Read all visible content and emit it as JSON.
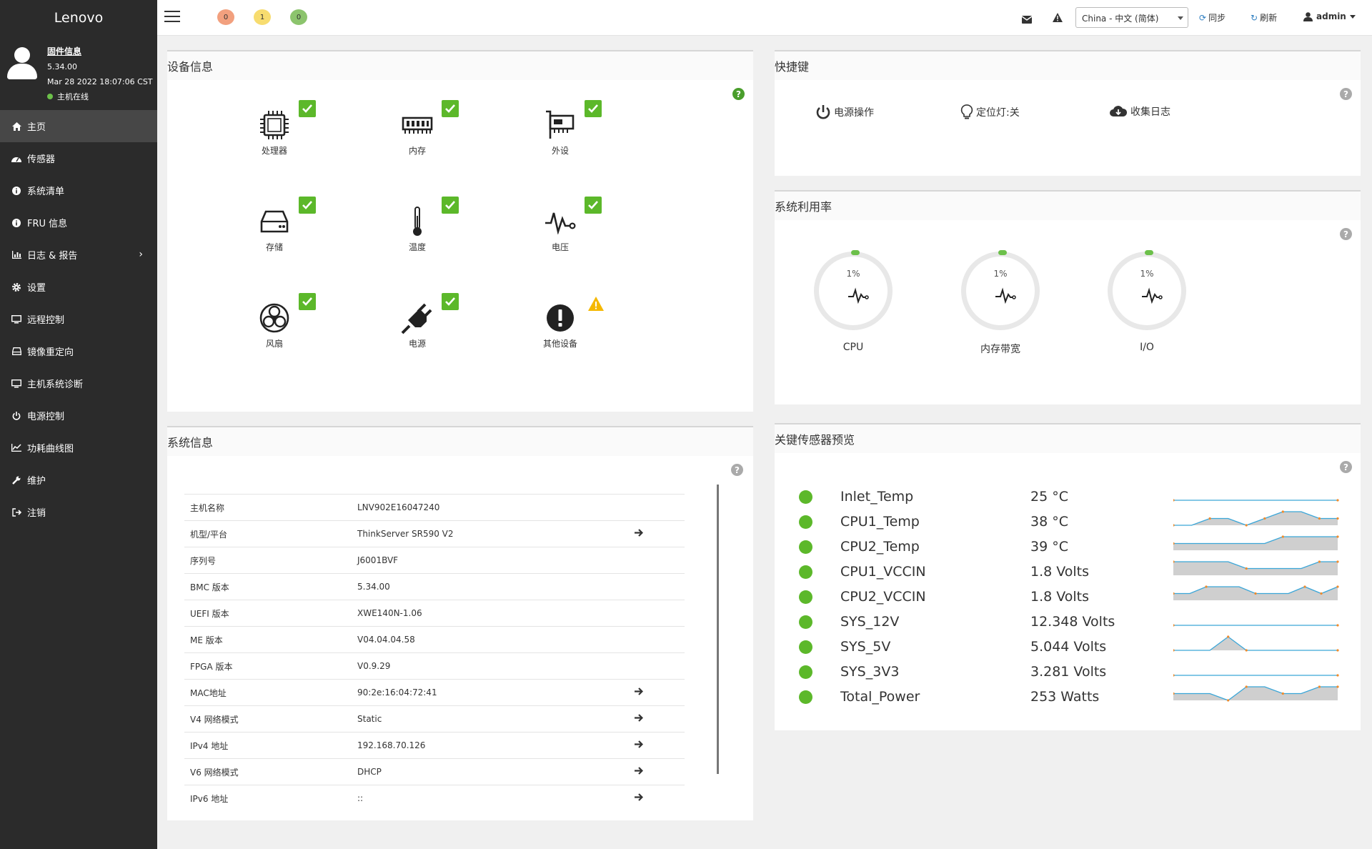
{
  "sidebar": {
    "brand": "Lenovo",
    "user": {
      "firmware_link": "固件信息",
      "version": "5.34.00",
      "datetime": "Mar 28 2022 18:07:06 CST",
      "status": "主机在线"
    },
    "items": [
      {
        "label": "主页",
        "icon": "home-icon"
      },
      {
        "label": "传感器",
        "icon": "dashboard-icon"
      },
      {
        "label": "系统清单",
        "icon": "info-icon"
      },
      {
        "label": "FRU 信息",
        "icon": "info-icon"
      },
      {
        "label": "日志 & 报告",
        "icon": "chart-icon"
      },
      {
        "label": "设置",
        "icon": "gear-icon"
      },
      {
        "label": "远程控制",
        "icon": "monitor-icon"
      },
      {
        "label": "镜像重定向",
        "icon": "disk-icon"
      },
      {
        "label": "主机系统诊断",
        "icon": "monitor-icon"
      },
      {
        "label": "电源控制",
        "icon": "power-icon"
      },
      {
        "label": "功耗曲线图",
        "icon": "line-chart-icon"
      },
      {
        "label": "维护",
        "icon": "wrench-icon"
      },
      {
        "label": "注销",
        "icon": "logout-icon"
      }
    ]
  },
  "topbar": {
    "badge_red": "0",
    "badge_yellow": "1",
    "badge_green": "0",
    "language": "China - 中文 (简体)",
    "sync": "同步",
    "refresh": "刷新",
    "user": "admin"
  },
  "device_info": {
    "title": "设备信息",
    "devices": [
      {
        "label": "处理器",
        "status": "ok"
      },
      {
        "label": "内存",
        "status": "ok"
      },
      {
        "label": "外设",
        "status": "ok"
      },
      {
        "label": "存储",
        "status": "ok"
      },
      {
        "label": "温度",
        "status": "ok"
      },
      {
        "label": "电压",
        "status": "ok"
      },
      {
        "label": "风扇",
        "status": "ok"
      },
      {
        "label": "电源",
        "status": "ok"
      },
      {
        "label": "其他设备",
        "status": "warning"
      }
    ]
  },
  "quick_keys": {
    "title": "快捷键",
    "power": "电源操作",
    "locator": "定位灯:关",
    "collect_log": "收集日志"
  },
  "utilization": {
    "title": "系统利用率",
    "gauges": [
      {
        "label": "CPU",
        "value": "1%"
      },
      {
        "label": "内存带宽",
        "value": "1%"
      },
      {
        "label": "I/O",
        "value": "1%"
      }
    ]
  },
  "system_info": {
    "title": "系统信息",
    "rows": [
      {
        "key": "主机名称",
        "value": "LNV902E16047240",
        "arrow": false
      },
      {
        "key": "机型/平台",
        "value": "ThinkServer SR590 V2",
        "arrow": true
      },
      {
        "key": "序列号",
        "value": "J6001BVF",
        "arrow": false
      },
      {
        "key": "BMC 版本",
        "value": "5.34.00",
        "arrow": false
      },
      {
        "key": "UEFI 版本",
        "value": "XWE140N-1.06",
        "arrow": false
      },
      {
        "key": "ME 版本",
        "value": "V04.04.04.58",
        "arrow": false
      },
      {
        "key": "FPGA 版本",
        "value": "V0.9.29",
        "arrow": false
      },
      {
        "key": "MAC地址",
        "value": "90:2e:16:04:72:41",
        "arrow": true
      },
      {
        "key": "V4 网络模式",
        "value": "Static",
        "arrow": true
      },
      {
        "key": "IPv4 地址",
        "value": "192.168.70.126",
        "arrow": true
      },
      {
        "key": "V6 网络模式",
        "value": "DHCP",
        "arrow": true
      },
      {
        "key": "IPv6 地址",
        "value": "::",
        "arrow": true
      }
    ]
  },
  "sensors": {
    "title": "关键传感器预览",
    "items": [
      {
        "name": "Inlet_Temp",
        "value": "25 °C",
        "trend": [
          0,
          0,
          0,
          0,
          0,
          0,
          0,
          0,
          0,
          0
        ]
      },
      {
        "name": "CPU1_Temp",
        "value": "38 °C",
        "trend": [
          0,
          0,
          1,
          1,
          0,
          1,
          2,
          2,
          1,
          1
        ]
      },
      {
        "name": "CPU2_Temp",
        "value": "39 °C",
        "trend": [
          1,
          1,
          1,
          1,
          1,
          1,
          2,
          2,
          2,
          2
        ]
      },
      {
        "name": "CPU1_VCCIN",
        "value": "1.8 Volts",
        "trend": [
          2,
          2,
          2,
          2,
          1,
          1,
          1,
          1,
          2,
          2
        ]
      },
      {
        "name": "CPU2_VCCIN",
        "value": "1.8 Volts",
        "trend": [
          1,
          1,
          2,
          2,
          2,
          1,
          1,
          1,
          2,
          1,
          2
        ]
      },
      {
        "name": "SYS_12V",
        "value": "12.348 Volts",
        "trend": [
          0,
          0,
          0,
          0,
          0,
          0,
          0,
          0,
          0,
          0
        ]
      },
      {
        "name": "SYS_5V",
        "value": "5.044 Volts",
        "trend": [
          0,
          0,
          0,
          2,
          0,
          0,
          0,
          0,
          0,
          0
        ]
      },
      {
        "name": "SYS_3V3",
        "value": "3.281 Volts",
        "trend": [
          0,
          0,
          0,
          0,
          0,
          0,
          0,
          0,
          0,
          0
        ]
      },
      {
        "name": "Total_Power",
        "value": "253 Watts",
        "trend": [
          1,
          1,
          1,
          0,
          2,
          2,
          1,
          1,
          2,
          2
        ]
      }
    ]
  },
  "colors": {
    "sidebar_bg": "#2b2b2b",
    "ok_green": "#5cb82a",
    "warning_yellow": "#f5b800",
    "accent_blue": "#2f7fc1"
  }
}
